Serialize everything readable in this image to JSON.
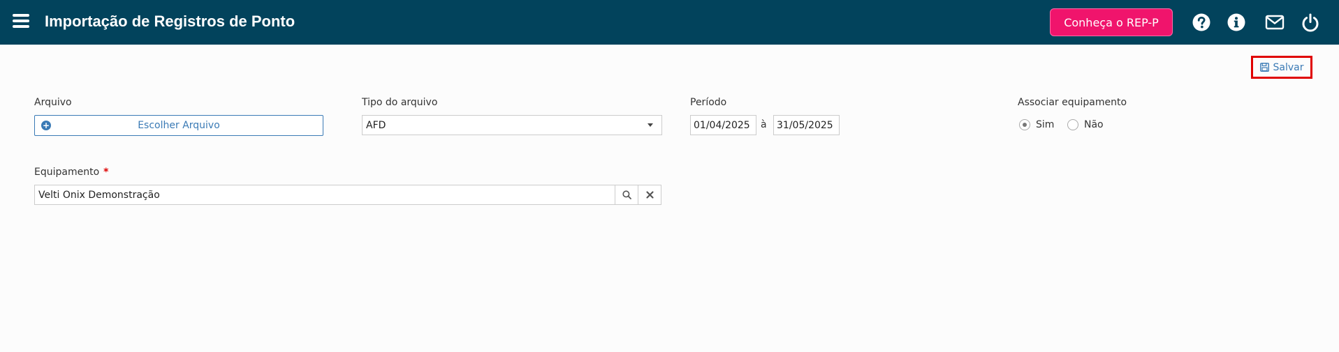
{
  "header": {
    "title": "Importação de Registros de Ponto",
    "rep_button": "Conheça o REP-P",
    "icons": [
      "menu-icon",
      "help-icon",
      "info-icon",
      "mail-icon",
      "power-icon"
    ]
  },
  "toolbar": {
    "save_label": "Salvar"
  },
  "form": {
    "arquivo_label": "Arquivo",
    "arquivo_button": "Escolher Arquivo",
    "tipo_label": "Tipo do arquivo",
    "tipo_value": "AFD",
    "periodo_label": "Período",
    "periodo_start": "01/04/2025",
    "periodo_sep": "à",
    "periodo_end": "31/05/2025",
    "associar_label": "Associar equipamento",
    "associar_options": [
      "Sim",
      "Não"
    ],
    "associar_selected": "Sim",
    "equipamento_label": "Equipamento",
    "equipamento_required": "*",
    "equipamento_value": "Velti Onix Demonstração"
  },
  "colors": {
    "header_bg": "#02435c",
    "accent_pink": "#f0146c",
    "link_blue": "#3a7ab5",
    "highlight_red": "#e00000"
  }
}
